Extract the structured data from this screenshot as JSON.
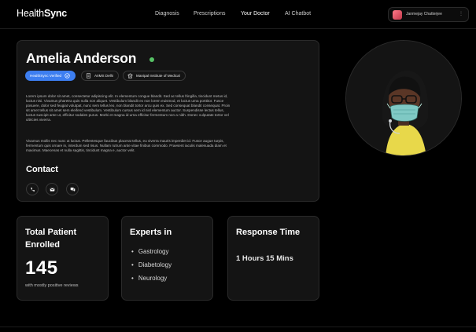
{
  "app": {
    "brand_light": "Health",
    "brand_bold": "Sync"
  },
  "nav": [
    {
      "label": "Diagnosis",
      "active": false
    },
    {
      "label": "Prescriptions",
      "active": false
    },
    {
      "label": "Your Doctor",
      "active": true
    },
    {
      "label": "AI Chatbot",
      "active": false
    }
  ],
  "user": {
    "name": "Janmejay Chatterjee"
  },
  "doctor": {
    "name": "Amelia Anderson",
    "status": "online",
    "badges": [
      {
        "label": "HealthSync Verified",
        "icon": "verified-check-icon"
      },
      {
        "label": "AIIMS Delhi",
        "icon": "document-icon"
      },
      {
        "label": "Manipal Institute of Medical",
        "icon": "building-icon"
      }
    ],
    "bio_1": "Lorem ipsum dolor sit amet, consectetur adipiscing elit. In elementum congue blandit. Sed ac tellus fringilla, tincidunt metus id, luctus nisi. Vivamus pharetra quis nulla non aliquet. Vestibulum blandit ex non lorem euismod, et luctus urna porttitor. Fusce posuere, dolor sed feugiat volutpat, nunc sem tellus leo, non blandit tortor arcu quis ex. Sed consequat blandit consequat. Proin sit amet tellus sit amet sem eleifend vestibulum. Vestibulum cursus sem id nisl elementum auctor. Suspendisse lectus tellus, luctus suscipit ante ut, efficitur sodales purus. Morbi et magna id urna efficitur fermentum non a nibh. Donec vulputate tortor vel ultricies viverra.",
    "bio_2": "Vivamus mollis nec nunc ut luctus. Pellentesque faucibus placerat tellus, eu viverra mauris imperdiet id. Fusce augue turpis, fermentum quis ornare in, interdum sed risus. Nullam rutrum ante vitae finibus commodo. Praesent iaculis malesuada diam et maximus. Maecenas et nulla sagittis, tincidunt magna e, auctor velit.",
    "contact_title": "Contact",
    "contact_buttons": [
      "phone-icon",
      "mail-icon",
      "chat-icon"
    ]
  },
  "stats": {
    "patients": {
      "title_1": "Total Patient",
      "title_2": "Enrolled",
      "value": "145",
      "subtitle": "with mostly positive reviews"
    },
    "experts": {
      "title": "Experts in",
      "items": [
        "Gastrology",
        "Diabetology",
        "Neurology"
      ]
    },
    "response": {
      "title": "Response Time",
      "value": "1 Hours 15 Mins"
    }
  },
  "colors": {
    "accent": "#3d7ef0",
    "online": "#56c265",
    "background": "#000000",
    "card": "#141414"
  }
}
